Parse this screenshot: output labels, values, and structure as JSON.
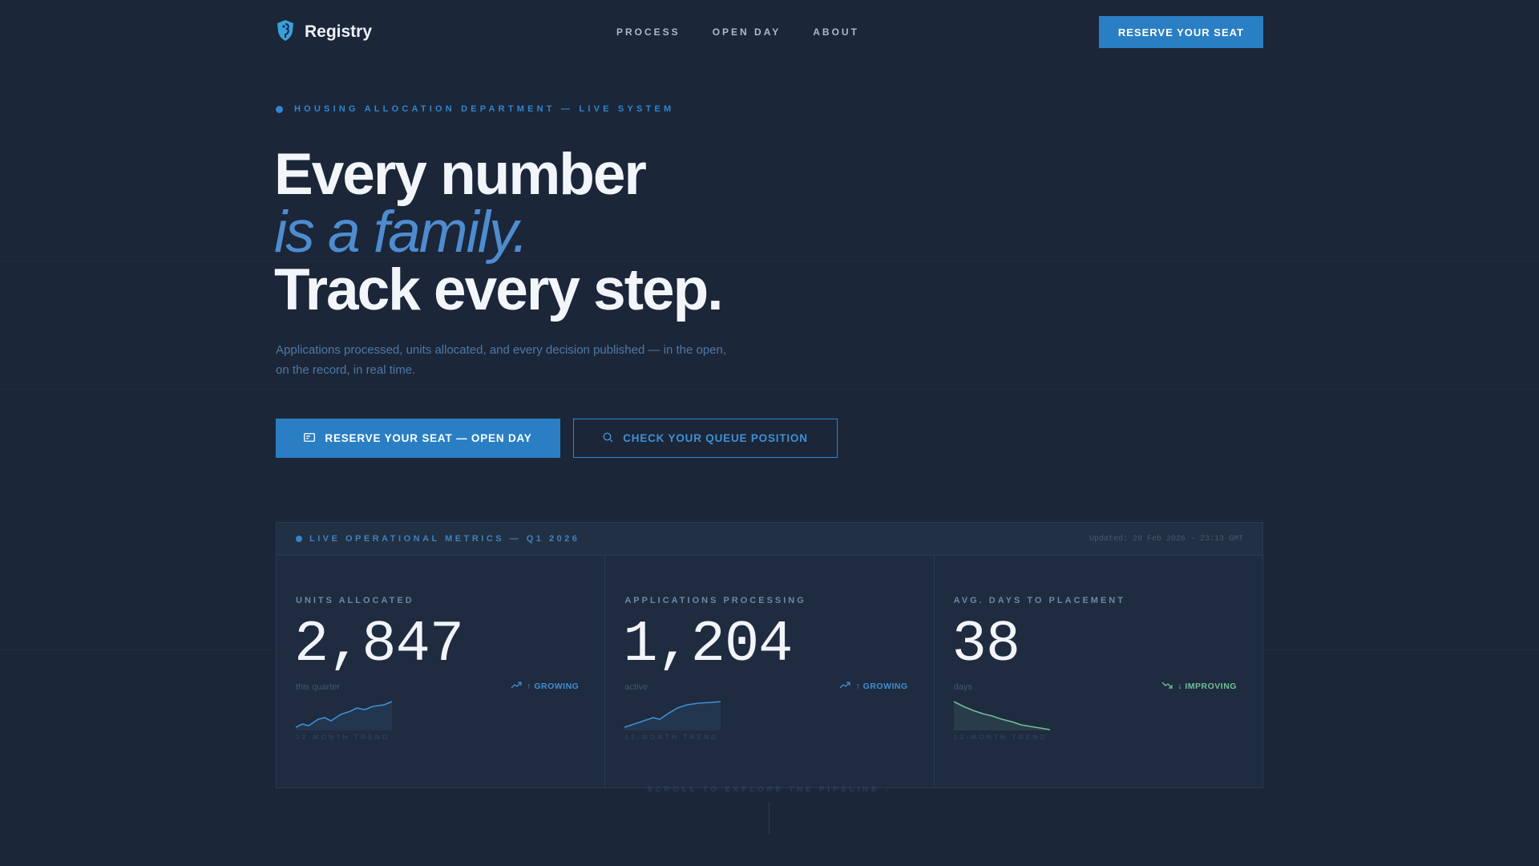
{
  "brand": {
    "name": "Registry",
    "logo_icon": "seahorse-shield-icon"
  },
  "nav": {
    "links": [
      "PROCESS",
      "OPEN DAY",
      "ABOUT"
    ],
    "cta": "RESERVE YOUR SEAT"
  },
  "hero": {
    "eyebrow": "HOUSING ALLOCATION DEPARTMENT — LIVE SYSTEM",
    "headline_line1": "Every number",
    "headline_line2": "is a family.",
    "headline_line3": "Track every step.",
    "subcopy": "Applications processed, units allocated, and every decision published — in the open, on the record, in real time.",
    "primary_button": {
      "label": "RESERVE YOUR SEAT — OPEN DAY",
      "icon": "ticket-icon"
    },
    "secondary_button": {
      "label": "CHECK YOUR QUEUE POSITION",
      "icon": "search-icon"
    }
  },
  "metrics_panel": {
    "title": "LIVE OPERATIONAL METRICS — Q1 2026",
    "updated": "Updated: 28 Feb 2026 · 23:13 GMT",
    "metrics": [
      {
        "label": "UNITS ALLOCATED",
        "value": "2,847",
        "unit": "this quarter",
        "trend": "↑ GROWING",
        "trend_icon": "trending-up-icon",
        "spark_label": "12-MONTH TREND",
        "color": "#3f8fd4"
      },
      {
        "label": "APPLICATIONS PROCESSING",
        "value": "1,204",
        "unit": "active",
        "trend": "↑ GROWING",
        "trend_icon": "trending-up-icon",
        "spark_label": "12-MONTH TREND",
        "color": "#3f8fd4"
      },
      {
        "label": "AVG. DAYS TO PLACEMENT",
        "value": "38",
        "unit": "days",
        "trend": "↓ IMPROVING",
        "trend_icon": "trending-down-icon",
        "spark_label": "12-MONTH TREND",
        "color": "#6fbf9a"
      }
    ]
  },
  "scroll_hint": "SCROLL TO EXPLORE THE PIPELINE ↓",
  "colors": {
    "accent": "#2a7fc4",
    "background": "#1b2638",
    "improving": "#6fbf9a"
  }
}
